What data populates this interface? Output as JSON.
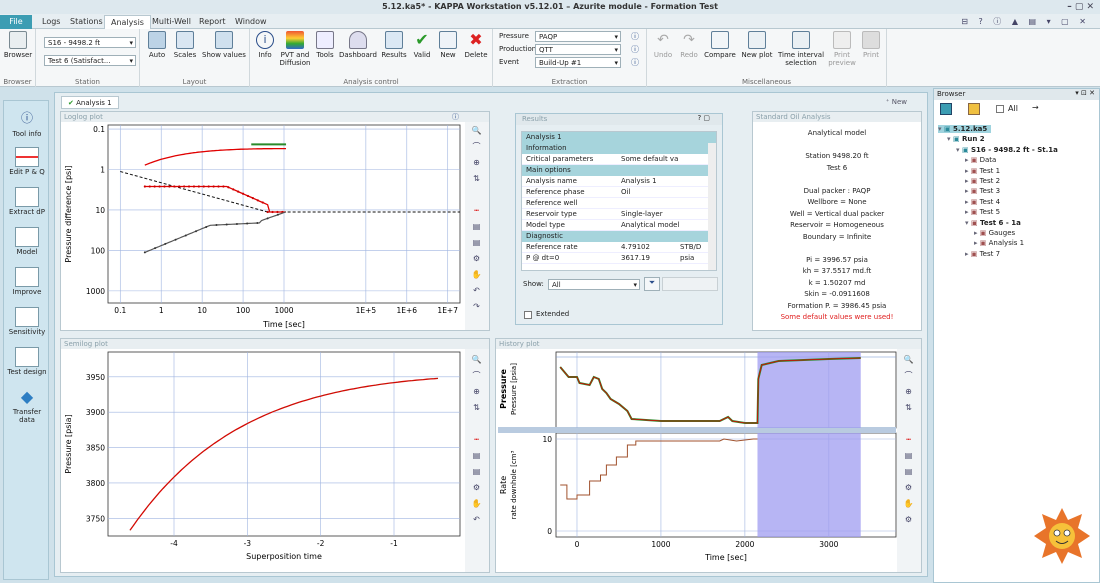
{
  "window": {
    "title": "5.12.ka5* - KAPPA Workstation v5.12.01 – Azurite module - Formation Test"
  },
  "tabs": [
    "File",
    "Logs",
    "Stations",
    "Analysis",
    "Multi-Well",
    "Report",
    "Window"
  ],
  "ribbon": {
    "browser_label": "Browser",
    "browser_group": "Browser",
    "station_select": "S16 - 9498.2 ft",
    "test_select": "Test 6 (Satisfact...",
    "station_group": "Station",
    "layout_buttons": [
      "Auto",
      "Scales",
      "Show values"
    ],
    "layout_group": "Layout",
    "analysis_buttons": [
      "Info",
      "PVT and Diffusion",
      "Tools",
      "Dashboard",
      "Results",
      "Valid",
      "New",
      "Delete"
    ],
    "analysis_group": "Analysis control",
    "extraction": {
      "pressure_label": "Pressure",
      "pressure_value": "PAQP",
      "production_label": "Production",
      "production_value": "QTT",
      "event_label": "Event",
      "event_value": "Build-Up #1"
    },
    "extraction_group": "Extraction",
    "misc_buttons": [
      "Undo",
      "Redo",
      "Compare",
      "New plot",
      "Time interval selection",
      "Print preview",
      "Print"
    ],
    "misc_group": "Miscellaneous"
  },
  "left_tools": [
    "Tool info",
    "Edit P & Q",
    "Extract dP",
    "Model",
    "Improve",
    "Sensitivity",
    "Test design",
    "Transfer data"
  ],
  "analysis_tab": "Analysis 1",
  "new_button": "New",
  "loglog": {
    "title": "Loglog plot",
    "xlabel": "Time [sec]",
    "ylabel": "Pressure difference [psi]",
    "xticks": [
      "0.1",
      "1",
      "10",
      "100",
      "1000",
      "1E+5",
      "1E+6",
      "1E+7"
    ],
    "yticks": [
      "0.1",
      "1",
      "10",
      "100",
      "1000"
    ]
  },
  "semilog": {
    "title": "Semilog plot",
    "xlabel": "Superposition time",
    "ylabel": "Pressure [psia]",
    "xticks": [
      "-4",
      "-3",
      "-2",
      "-1"
    ],
    "yticks": [
      "3950",
      "3900",
      "3850",
      "3800",
      "3750"
    ]
  },
  "history": {
    "title": "History plot",
    "xlabel": "Time [sec]",
    "ylabel_p1": "Pressure",
    "ylabel_p2": "Pressure [psia]",
    "ylabel_r1": "Rate",
    "ylabel_r2": "rate downhole [cm³",
    "xticks": [
      "0",
      "1000",
      "2000",
      "3000"
    ],
    "yticks_rate": [
      "10",
      "0"
    ]
  },
  "results": {
    "title": "Results",
    "subtitle": "Analysis 1",
    "sections": [
      {
        "name": "Information",
        "rows": [
          [
            "Critical parameters",
            "Some default values wer...",
            ""
          ]
        ]
      },
      {
        "name": "Main options",
        "rows": [
          [
            "Analysis name",
            "Analysis 1",
            ""
          ],
          [
            "Reference phase",
            "Oil",
            ""
          ],
          [
            "Reference well",
            "",
            ""
          ],
          [
            "Reservoir type",
            "Single-layer",
            ""
          ],
          [
            "Model type",
            "Analytical model",
            ""
          ]
        ]
      },
      {
        "name": "Diagnostic",
        "rows": [
          [
            "Reference rate",
            "4.79102",
            "STB/D"
          ],
          [
            "P @ dt=0",
            "3617.19",
            "psia"
          ]
        ]
      }
    ],
    "show_label": "Show:",
    "show_value": "All",
    "extended_label": "Extended"
  },
  "summary": {
    "title": "Standard Oil Analysis",
    "lines": [
      "Analytical model",
      "",
      "Station 9498.20 ft",
      "Test 6",
      "",
      "Dual packer : PAQP",
      "Wellbore = None",
      "Well = Vertical dual packer",
      "Reservoir = Homogeneous",
      "Boundary = Infinite",
      "",
      "Pi = 3996.57 psia",
      "kh = 37.5517 md.ft",
      "k = 1.50207 md",
      "Skin = -0.0911608",
      "Formation P. = 3986.45 psia"
    ],
    "warning": "Some default values were used!",
    "warning_color": "#e02020"
  },
  "browser": {
    "title": "Browser",
    "all_label": "All",
    "tree": [
      [
        "5.12.ka5",
        0,
        true
      ],
      [
        "Run 2",
        1,
        true
      ],
      [
        "S16 - 9498.2 ft - St.1a",
        2,
        true
      ],
      [
        "Data",
        3,
        false
      ],
      [
        "Test 1",
        3,
        false
      ],
      [
        "Test 2",
        3,
        false
      ],
      [
        "Test 3",
        3,
        false
      ],
      [
        "Test 4",
        3,
        false
      ],
      [
        "Test 5",
        3,
        false
      ],
      [
        "Test 6 - 1a",
        3,
        true
      ],
      [
        "Gauges",
        4,
        false
      ],
      [
        "Analysis 1",
        4,
        false
      ],
      [
        "Test 7",
        3,
        false
      ]
    ]
  },
  "colors": {
    "accent": "#3c9db3",
    "model_red": "#e00000",
    "data_green": "#2a8a2a",
    "interval_blue": "#9f9cf0"
  }
}
